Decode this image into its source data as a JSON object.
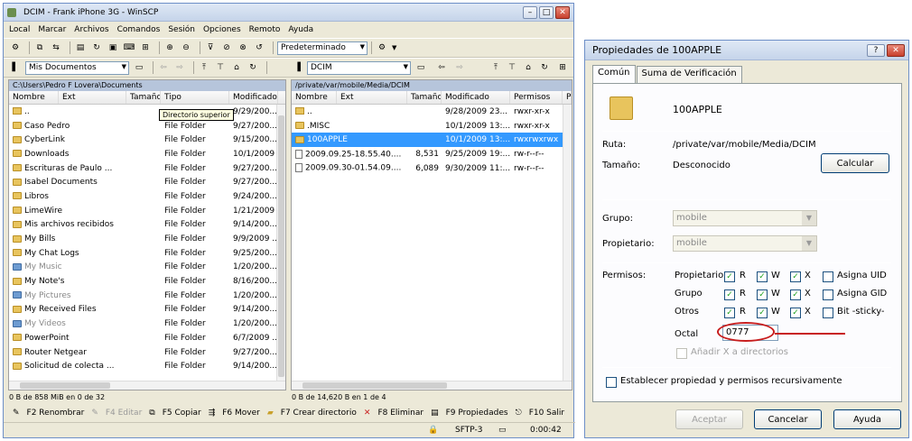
{
  "main": {
    "title": "DCIM - Frank iPhone 3G - WinSCP",
    "menu": [
      "Local",
      "Marcar",
      "Archivos",
      "Comandos",
      "Sesión",
      "Opciones",
      "Remoto",
      "Ayuda"
    ],
    "preset": "Predeterminado",
    "left_location": "Mis Documentos",
    "right_location": "DCIM",
    "left_path": "C:\\Users\\Pedro F Lovera\\Documents",
    "right_path": "/private/var/mobile/Media/DCIM",
    "left_headers": [
      "Nombre",
      "Ext",
      "Tamaño",
      "Tipo",
      "Modificado"
    ],
    "right_headers": [
      "Nombre",
      "Ext",
      "Tamaño",
      "Modificado",
      "Permisos",
      "P"
    ],
    "left_rows": [
      {
        "name": "..",
        "type": "",
        "mod": "9/29/200...",
        "icon": "up"
      },
      {
        "name": "Caso Pedro",
        "type": "File Folder",
        "mod": "9/27/200...",
        "icon": "folder"
      },
      {
        "name": "CyberLink",
        "type": "File Folder",
        "mod": "9/15/200...",
        "icon": "folder"
      },
      {
        "name": "Downloads",
        "type": "File Folder",
        "mod": "10/1/2009 ...",
        "icon": "folder"
      },
      {
        "name": "Escrituras de Paulo ...",
        "type": "File Folder",
        "mod": "9/27/200...",
        "icon": "folder"
      },
      {
        "name": "Isabel Documents",
        "type": "File Folder",
        "mod": "9/27/200...",
        "icon": "folder"
      },
      {
        "name": "Libros",
        "type": "File Folder",
        "mod": "9/24/200...",
        "icon": "folder"
      },
      {
        "name": "LimeWire",
        "type": "File Folder",
        "mod": "1/21/2009 ...",
        "icon": "folder"
      },
      {
        "name": "Mis archivos recibidos",
        "type": "File Folder",
        "mod": "9/14/200...",
        "icon": "folder"
      },
      {
        "name": "My Bills",
        "type": "File Folder",
        "mod": "9/9/2009 ...",
        "icon": "folder"
      },
      {
        "name": "My Chat Logs",
        "type": "File Folder",
        "mod": "9/25/200...",
        "icon": "folder"
      },
      {
        "name": "My Music",
        "type": "File Folder",
        "mod": "1/20/200...",
        "icon": "sys",
        "grey": true
      },
      {
        "name": "My Note's",
        "type": "File Folder",
        "mod": "8/16/200...",
        "icon": "folder"
      },
      {
        "name": "My Pictures",
        "type": "File Folder",
        "mod": "1/20/200...",
        "icon": "sys",
        "grey": true
      },
      {
        "name": "My Received Files",
        "type": "File Folder",
        "mod": "9/14/200...",
        "icon": "folder"
      },
      {
        "name": "My Videos",
        "type": "File Folder",
        "mod": "1/20/200...",
        "icon": "sys",
        "grey": true
      },
      {
        "name": "PowerPoint",
        "type": "File Folder",
        "mod": "6/7/2009 ...",
        "icon": "folder"
      },
      {
        "name": "Router Netgear",
        "type": "File Folder",
        "mod": "9/27/200...",
        "icon": "folder"
      },
      {
        "name": "Solicitud de colecta ...",
        "type": "File Folder",
        "mod": "9/14/200...",
        "icon": "folder"
      }
    ],
    "right_rows": [
      {
        "name": "..",
        "size": "",
        "mod": "9/28/2009 23...",
        "perm": "rwxr-xr-x",
        "p": "r",
        "icon": "up"
      },
      {
        "name": ".MISC",
        "size": "",
        "mod": "10/1/2009 13:...",
        "perm": "rwxr-xr-x",
        "p": "r",
        "icon": "folder"
      },
      {
        "name": "100APPLE",
        "size": "",
        "mod": "10/1/2009 13:...",
        "perm": "rwxrwxrwx",
        "p": "r",
        "icon": "folder",
        "sel": true
      },
      {
        "name": "2009.09.25-18.55.40....",
        "size": "8,531",
        "mod": "9/25/2009 19:...",
        "perm": "rw-r--r--",
        "p": "r",
        "icon": "file"
      },
      {
        "name": "2009.09.30-01.54.09....",
        "size": "6,089",
        "mod": "9/30/2009 11:...",
        "perm": "rw-r--r--",
        "p": "r",
        "icon": "file"
      }
    ],
    "tooltip": "Directorio superior",
    "left_status": "0 B de 858 MiB en 0 de 32",
    "right_status": "0 B de 14,620 B en 1 de 4",
    "fkeys": [
      {
        "label": "F2 Renombrar",
        "disabled": false
      },
      {
        "label": "F4 Editar",
        "disabled": true
      },
      {
        "label": "F5 Copiar",
        "disabled": false
      },
      {
        "label": "F6 Mover",
        "disabled": false
      },
      {
        "label": "F7 Crear directorio",
        "disabled": false
      },
      {
        "label": "F8 Eliminar",
        "disabled": false
      },
      {
        "label": "F9 Propiedades",
        "disabled": false
      },
      {
        "label": "F10 Salir",
        "disabled": false
      }
    ],
    "protocol": "SFTP-3",
    "time": "0:00:42"
  },
  "dialog": {
    "title": "Propiedades de 100APPLE",
    "tabs": [
      "Común",
      "Suma de Verificación"
    ],
    "name": "100APPLE",
    "ruta_label": "Ruta:",
    "ruta_value": "/private/var/mobile/Media/DCIM",
    "tamano_label": "Tamaño:",
    "tamano_value": "Desconocido",
    "calcular": "Calcular",
    "grupo_label": "Grupo:",
    "grupo_value": "mobile",
    "propietario_label": "Propietario:",
    "propietario_value": "mobile",
    "permisos_label": "Permisos:",
    "perm_rows": [
      {
        "label": "Propietario",
        "extra": "Asigna UID"
      },
      {
        "label": "Grupo",
        "extra": "Asigna GID"
      },
      {
        "label": "Otros",
        "extra": "Bit -sticky-"
      }
    ],
    "r": "R",
    "w": "W",
    "x": "X",
    "octal_label": "Octal",
    "octal_value": "0777",
    "add_x": "Añadir X a directorios",
    "recursive": "Establecer propiedad y permisos recursivamente",
    "aceptar": "Aceptar",
    "cancelar": "Cancelar",
    "ayuda": "Ayuda"
  }
}
